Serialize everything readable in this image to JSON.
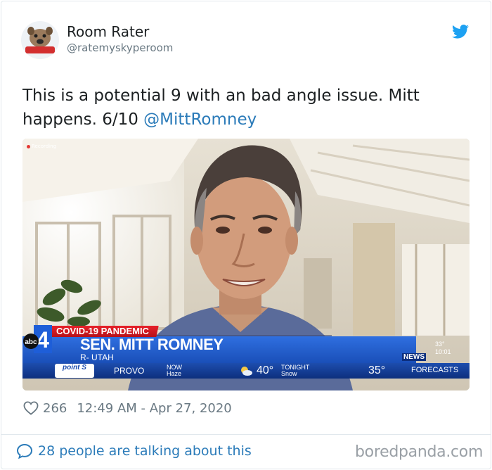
{
  "author": {
    "display_name": "Room Rater",
    "handle": "@ratemyskyperoom",
    "avatar_text": "MAD DOG PAC"
  },
  "tweet": {
    "text": "This is a potential 9 with an bad angle issue. Mitt happens. 6/10 ",
    "mention": "@MittRomney"
  },
  "media": {
    "recording_label": "Recording",
    "banner": "COVID-19 PANDEMIC",
    "name": "SEN. MITT ROMNEY",
    "title": "R- UTAH",
    "station_logo": "abc4",
    "station_news": "NEWS",
    "clock_temp": "33°",
    "clock_time": "10:01",
    "sponsor": "point",
    "sponsor_mark": "S",
    "location": "PROVO",
    "now_label": "NOW",
    "now_condition": "Haze",
    "now_temp": "40°",
    "tonight_label": "TONIGHT",
    "tonight_condition": "Snow",
    "tonight_temp": "35°",
    "forecasts": "FORECASTS"
  },
  "meta": {
    "likes": "266",
    "timestamp": "12:49 AM - Apr 27, 2020"
  },
  "footer": {
    "talking": "28 people are talking about this",
    "watermark": "boredpanda.com"
  },
  "colors": {
    "twitter_blue": "#1da1f2",
    "link_blue": "#2b7bb9",
    "muted_gray": "#697882"
  }
}
